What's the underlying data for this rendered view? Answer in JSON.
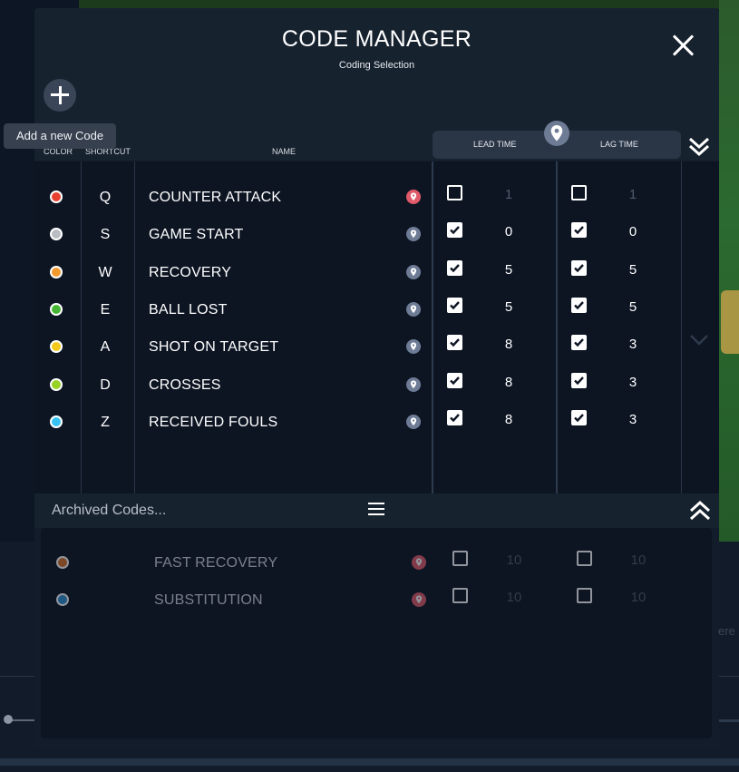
{
  "modal": {
    "title": "CODE MANAGER",
    "subtitle": "Coding Selection",
    "add_tooltip": "Add a new Code"
  },
  "columns": {
    "color": "COLOR",
    "shortcut": "SHORTCUT",
    "name": "NAME",
    "lead_time": "LEAD TIME",
    "lag_time": "LAG TIME"
  },
  "codes": [
    {
      "color": "#e8412f",
      "shortcut": "Q",
      "name": "COUNTER ATTACK",
      "pin_color": "#e05a6a",
      "lead_checked": false,
      "lead": "1",
      "lag_checked": false,
      "lag": "1"
    },
    {
      "color": "#b9bcc1",
      "shortcut": "S",
      "name": "GAME START",
      "pin_color": "#6d7b95",
      "lead_checked": true,
      "lead": "0",
      "lag_checked": true,
      "lag": "0"
    },
    {
      "color": "#f39a2e",
      "shortcut": "W",
      "name": "RECOVERY",
      "pin_color": "#6d7b95",
      "lead_checked": true,
      "lead": "5",
      "lag_checked": true,
      "lag": "5"
    },
    {
      "color": "#46b534",
      "shortcut": "E",
      "name": "BALL LOST",
      "pin_color": "#6d7b95",
      "lead_checked": true,
      "lead": "5",
      "lag_checked": true,
      "lag": "5"
    },
    {
      "color": "#f5c91b",
      "shortcut": "A",
      "name": "SHOT ON TARGET",
      "pin_color": "#6d7b95",
      "lead_checked": true,
      "lead": "8",
      "lag_checked": true,
      "lag": "3"
    },
    {
      "color": "#98d125",
      "shortcut": "D",
      "name": "CROSSES",
      "pin_color": "#6d7b95",
      "lead_checked": true,
      "lead": "8",
      "lag_checked": true,
      "lag": "3"
    },
    {
      "color": "#37c3f2",
      "shortcut": "Z",
      "name": "RECEIVED FOULS",
      "pin_color": "#6d7b95",
      "lead_checked": true,
      "lead": "8",
      "lag_checked": true,
      "lag": "3"
    }
  ],
  "archived": {
    "label": "Archived Codes...",
    "codes": [
      {
        "color": "#d8702a",
        "name": "FAST RECOVERY",
        "pin_color": "#e05a6a",
        "lead_checked": false,
        "lead": "10",
        "lag_checked": false,
        "lag": "10"
      },
      {
        "color": "#2e8fd0",
        "name": "SUBSTITUTION",
        "pin_color": "#e05a6a",
        "lead_checked": false,
        "lead": "10",
        "lag_checked": false,
        "lag": "10"
      }
    ]
  },
  "icons": {
    "close": "close-icon",
    "add": "plus-icon",
    "pin": "map-pin-icon",
    "collapse": "double-chevron-down-icon",
    "expand": "double-chevron-up-icon",
    "menu": "hamburger-menu-icon"
  }
}
